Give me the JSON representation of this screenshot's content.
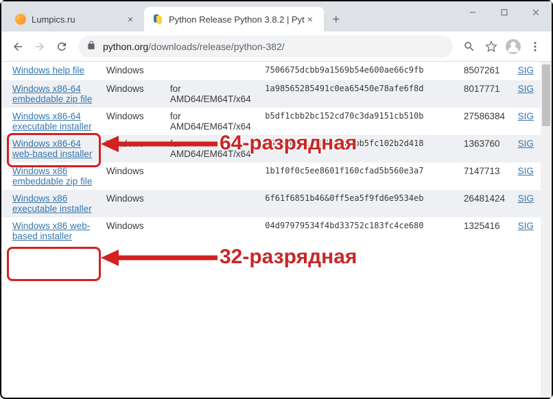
{
  "tabs": [
    {
      "title": "Lumpics.ru"
    },
    {
      "title": "Python Release Python 3.8.2 | Pyt"
    }
  ],
  "url": {
    "domain": "python.org",
    "path": "/downloads/release/python-382/"
  },
  "rows": [
    {
      "name": "Windows help file",
      "os": "Windows",
      "desc": "",
      "md5": "7506675dcbb9a1569b54e600ae66c9fb",
      "size": "8507261",
      "sig": "SIG"
    },
    {
      "name": "Windows x86-64 embeddable zip file",
      "os": "Windows",
      "desc": "for AMD64/EM64T/x64",
      "md5": "1a98565285491c0ea65450e78afe6f8d",
      "size": "8017771",
      "sig": "SIG"
    },
    {
      "name": "Windows x86-64 executable installer",
      "os": "Windows",
      "desc": "for AMD64/EM64T/x64",
      "md5": "b5df1cbb2bc152cd70c3da9151cb510b",
      "size": "27586384",
      "sig": "SIG"
    },
    {
      "name": "Windows x86-64 web-based installer",
      "os": "Windows",
      "desc": "for AMD64/EM64T/x64",
      "md5": "2586cdad1a363d1a8abb5fc102b2d418",
      "size": "1363760",
      "sig": "SIG"
    },
    {
      "name": "Windows x86 embeddable zip file",
      "os": "Windows",
      "desc": "",
      "md5": "1b1f0f0c5ee8601f160cfad5b560e3a7",
      "size": "7147713",
      "sig": "SIG"
    },
    {
      "name": "Windows x86 executable installer",
      "os": "Windows",
      "desc": "",
      "md5": "6f61f6851b46&0ff5ea5f9fd6e9534eb",
      "size": "26481424",
      "sig": "SIG"
    },
    {
      "name": "Windows x86 web-based installer",
      "os": "Windows",
      "desc": "",
      "md5": "04d97979534f4bd33752c183fc4ce680",
      "size": "1325416",
      "sig": "SIG"
    }
  ],
  "annotations": {
    "a64": "64-разрядная",
    "a32": "32-разрядная"
  }
}
